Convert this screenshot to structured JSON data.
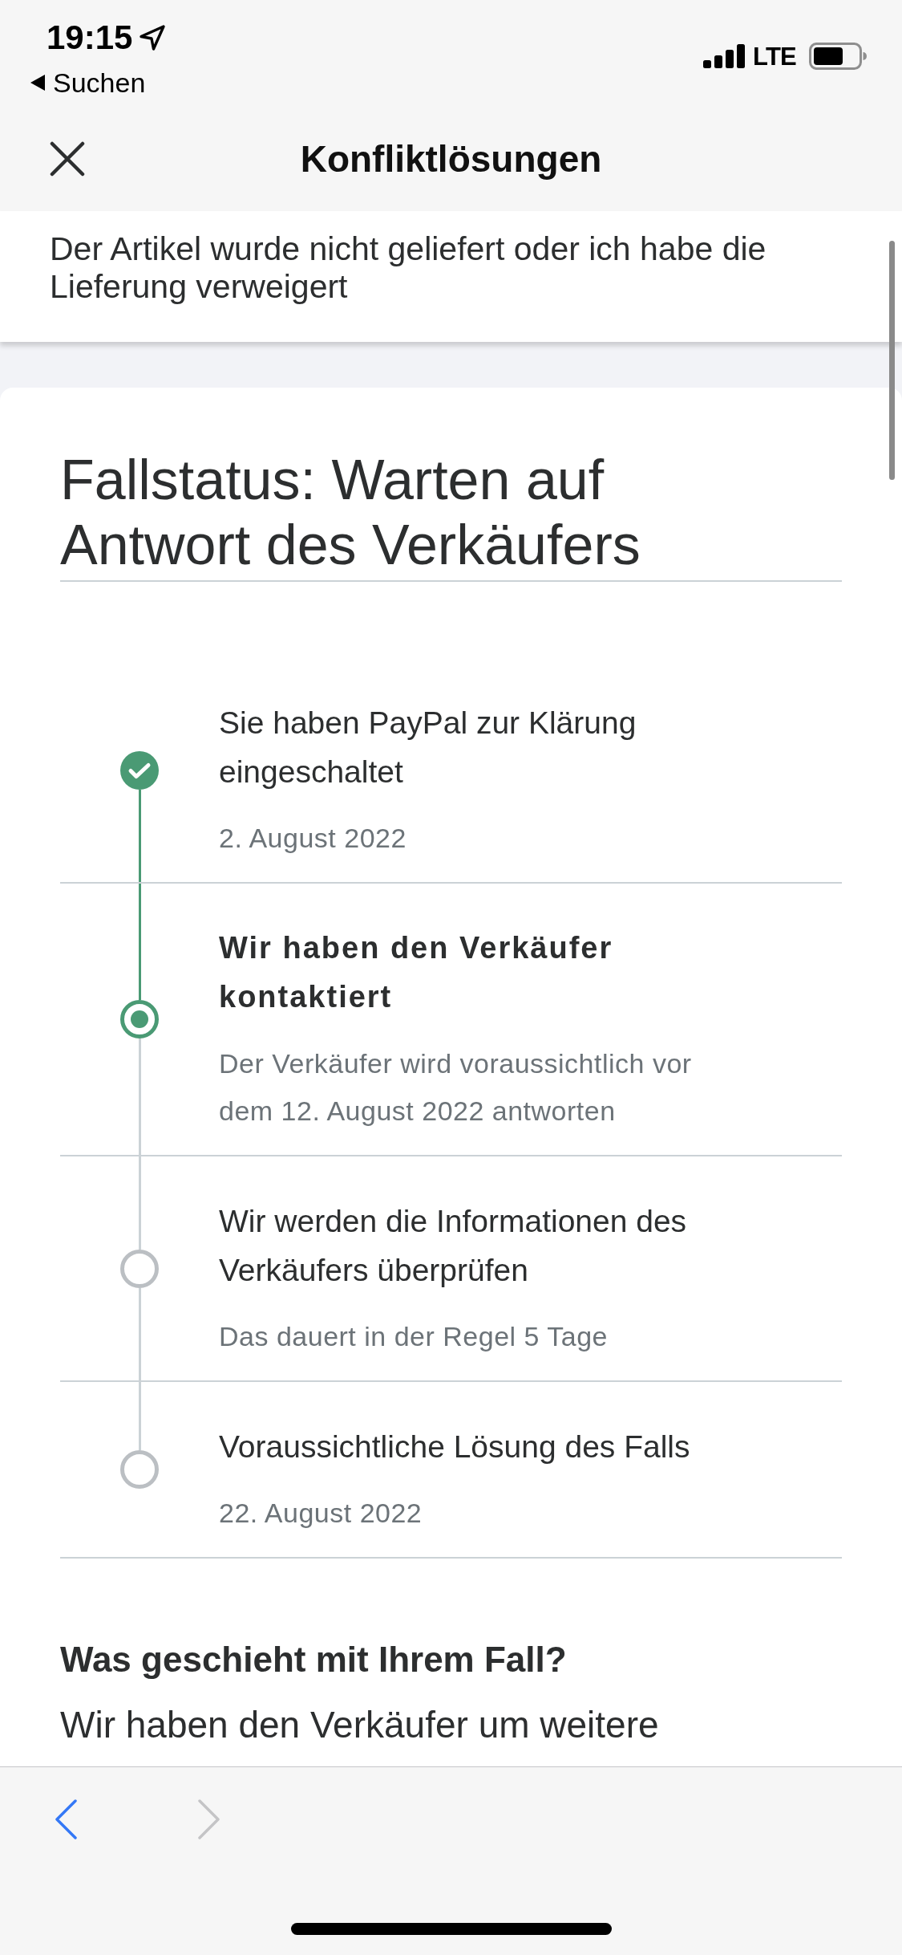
{
  "status_bar": {
    "time": "19:15",
    "back_link": "Suchen",
    "network": "LTE"
  },
  "nav_bar": {
    "title": "Konfliktlösungen"
  },
  "banner": {
    "text": "Der Artikel wurde nicht geliefert oder ich habe die Lieferung verweigert"
  },
  "case_status": {
    "heading": "Fallstatus: Warten auf Antwort des Verkäufers",
    "steps": [
      {
        "title": "Sie haben PayPal zur Klärung eingeschaltet",
        "detail": "2. August 2022",
        "done": true,
        "current": false
      },
      {
        "title": "Wir haben den Verkäufer kontaktiert",
        "detail": "Der Verkäufer wird voraussichtlich vor dem 12. August 2022 antworten",
        "done": false,
        "current": true
      },
      {
        "title": "Wir werden die Informationen des Verkäufers überprüfen",
        "detail": "Das dauert in der Regel 5 Tage",
        "done": false,
        "current": false
      },
      {
        "title": "Voraussichtliche Lösung des Falls",
        "detail": "22. August 2022",
        "done": false,
        "current": false
      }
    ]
  },
  "explanation": {
    "heading": "Was geschieht mit Ihrem Fall?",
    "text": "Wir haben den Verkäufer um weitere"
  },
  "toolbar": {
    "back": {
      "disabled": false
    },
    "forward": {
      "disabled": true
    }
  }
}
